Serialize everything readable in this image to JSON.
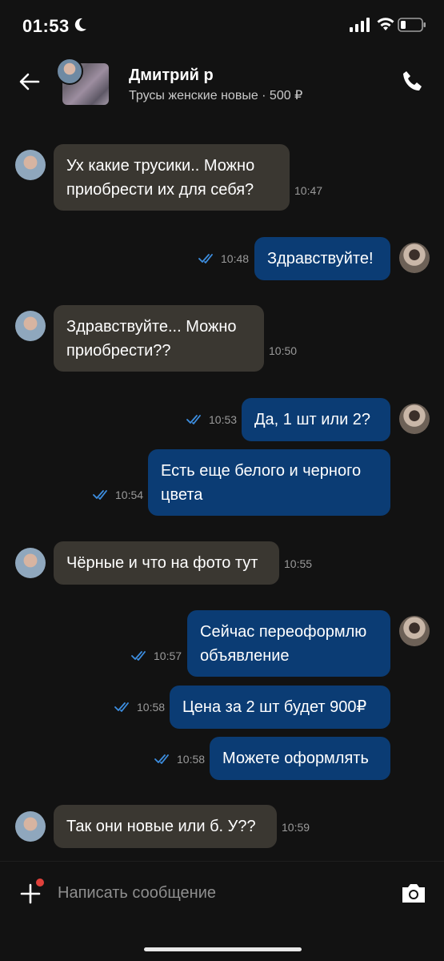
{
  "status": {
    "time": "01:53"
  },
  "header": {
    "name": "Дмитрий р",
    "subtitle": "Трусы женские новые · 500 ₽"
  },
  "messages": [
    {
      "side": "in",
      "text": "Ух какие трусики.. Можно приобрести их для себя?",
      "time": "10:47"
    },
    {
      "side": "out",
      "text": "Здравствуйте!",
      "time": "10:48"
    },
    {
      "side": "in",
      "text": "Здравствуйте... Можно приобрести??",
      "time": "10:50"
    },
    {
      "side": "out",
      "text": "Да, 1 шт или 2?",
      "time": "10:53"
    },
    {
      "side": "out",
      "text": "Есть еще белого и черного цвета",
      "time": "10:54"
    },
    {
      "side": "in",
      "text": "Чёрные и что на фото тут",
      "time": "10:55"
    },
    {
      "side": "out",
      "text": "Сейчас переоформлю объявление",
      "time": "10:57"
    },
    {
      "side": "out",
      "text": "Цена за 2 шт будет 900₽",
      "time": "10:58"
    },
    {
      "side": "out",
      "text": "Можете оформлять",
      "time": "10:58"
    },
    {
      "side": "in",
      "text": "Так они новые или б. У??",
      "time": "10:59"
    }
  ],
  "composer": {
    "placeholder": "Написать сообщение"
  },
  "colors": {
    "incoming": "#3a3731",
    "outgoing": "#0b3c74",
    "read_check": "#3d8ee0",
    "unread_dot": "#e0413b"
  }
}
